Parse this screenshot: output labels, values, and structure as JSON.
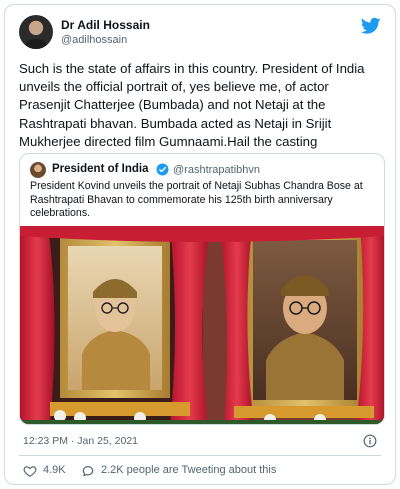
{
  "user": {
    "name": "Dr Adil Hossain",
    "handle": "@adilhossain"
  },
  "tweet": {
    "text": "Such is the state of affairs in this country. President of India unveils the official portrait of, yes believe me, of actor Prasenjit Chatterjee (Bumbada) and not Netaji at the Rashtrapati bhavan. Bumbada acted as Netaji in Srijit Mukherjee directed film Gumnaami.Hail the casting"
  },
  "quote": {
    "name": "President of India",
    "handle": "@rashtrapatibhvn",
    "text": "President Kovind unveils the portrait of Netaji Subhas Chandra Bose at Rashtrapati Bhavan to commemorate his 125th birth anniversary celebrations.",
    "verified": true,
    "image_alt_icon": "portrait-photo"
  },
  "meta": {
    "timestamp": "12:23 PM · Jan 25, 2021"
  },
  "actions": {
    "likes": "4.9K",
    "tweeting_text": "2.2K people are Tweeting about this"
  },
  "colors": {
    "twitter_blue": "#1d9bf0",
    "secondary_text": "#536471",
    "border": "#cfd9de",
    "heart": "#536471"
  },
  "icons": [
    "twitter-logo-icon",
    "verified-badge-icon",
    "info-icon",
    "heart-icon",
    "reply-bubble-icon"
  ]
}
